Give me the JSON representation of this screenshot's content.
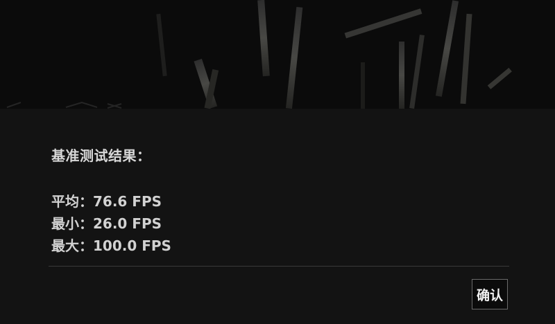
{
  "dialog": {
    "heading": "基准测试结果：",
    "stats": {
      "avg": "平均：76.6 FPS",
      "min": "最小：26.0 FPS",
      "max": "最大：100.0 FPS"
    },
    "confirm_label": "确认"
  }
}
